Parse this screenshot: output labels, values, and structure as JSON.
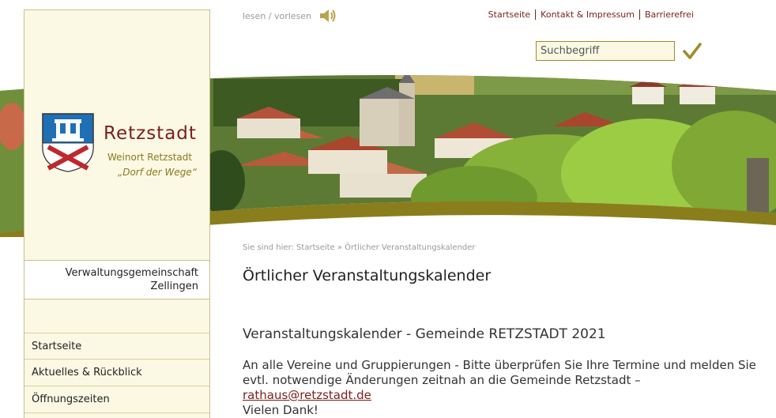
{
  "sidebar": {
    "town_name": "Retzstadt",
    "town_subtitle": "Weinort Retzstadt",
    "town_motto": "„Dorf der Wege“",
    "vgem_line1": "Verwaltungsgemeinschaft",
    "vgem_line2": "Zellingen",
    "nav_items": [
      {
        "label": "Startseite"
      },
      {
        "label": "Aktuelles & Rückblick"
      },
      {
        "label": "Öffnungszeiten"
      }
    ]
  },
  "header": {
    "read_aloud_label": "lesen / vorlesen",
    "top_links": [
      "Startseite",
      "Kontakt & Impressum",
      "Barrierefrei"
    ],
    "search_placeholder": "Suchbegriff"
  },
  "content": {
    "breadcrumb": "Sie sind hier: Startseite » Örtlicher Veranstaltungskalender",
    "page_title": "Örtlicher Veranstaltungskalender",
    "calendar_heading": "Veranstaltungskalender - Gemeinde RETZSTADT 2021",
    "intro_text": "An alle Vereine und Gruppierungen - Bitte überprüfen Sie Ihre Termine und melden Sie evtl. notwendige Änderungen zeitnah an die Gemeinde Retzstadt – ",
    "email": "rathaus@retzstadt.de",
    "thanks": "Vielen Dank!"
  },
  "colors": {
    "brand_red": "#7a1f1a",
    "olive": "#8b7a1a",
    "sidebar_bg": "#fbf8e4"
  },
  "icons": {
    "speaker": "speaker-icon",
    "search_submit": "checkmark-icon",
    "crest": "coat-of-arms"
  }
}
